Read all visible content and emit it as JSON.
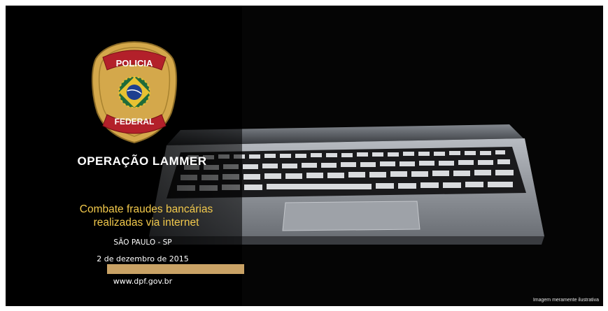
{
  "badge": {
    "top_text": "POLICIA",
    "bottom_text": "FEDERAL"
  },
  "slide": {
    "title": "OPERAÇÃO LAMMER",
    "subtitle_line1": "Combate fraudes bancárias",
    "subtitle_line2": "realizadas via internet",
    "location": "SÃO PAULO - SP",
    "date": "2 de dezembro de 2015",
    "website": "www.dpf.gov.br",
    "caption": "Imagem meramente ilustrativa"
  },
  "colors": {
    "background": "#000000",
    "subtitle": "#f2c94c",
    "accent_bar": "#c9a265",
    "badge_gold": "#d4a84b",
    "badge_red": "#b3202a"
  }
}
